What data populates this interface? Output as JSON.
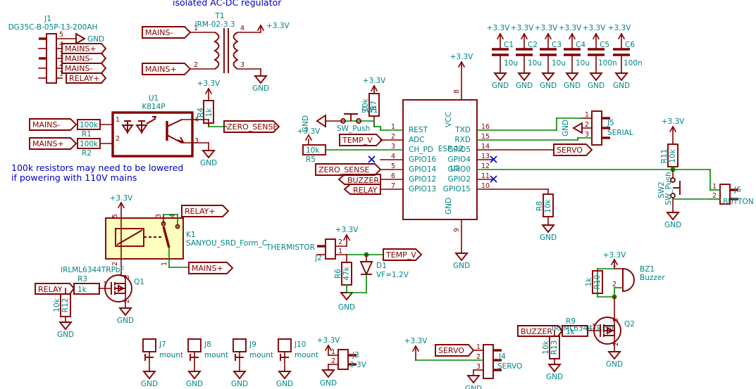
{
  "sheet": {
    "title_block_note": "isolated AC-DC regulator",
    "warning_note_line1": "100k resistors may need to be lowered",
    "warning_note_line2": "if powering with 110V mains"
  },
  "nets": {
    "vcc": "+3.3V",
    "gnd": "GND",
    "mains_plus": "MAINS+",
    "mains_minus": "MAINS-",
    "relay_plus": "RELAY+",
    "relay": "RELAY",
    "zero_sense": "ZERO_SENSE",
    "temp_v": "TEMP_V",
    "buzzer": "BUZZER",
    "servo": "SERVO"
  },
  "components": {
    "J1": {
      "ref": "J1",
      "value": "DG35C-B-05P-13-200AH",
      "pins": [
        {
          "num": "5",
          "label": "GND"
        },
        {
          "num": "4",
          "label": "MAINS+"
        },
        {
          "num": "3",
          "label": "MAINS-"
        },
        {
          "num": "2",
          "label": "MAINS-"
        },
        {
          "num": "1",
          "label": "RELAY+"
        }
      ]
    },
    "T1": {
      "ref": "T1",
      "value": "IRM-02-3.3",
      "pins": [
        "1",
        "2",
        "3",
        "4"
      ],
      "in_minus": "MAINS-",
      "in_plus": "MAINS+",
      "out_plus": "+3.3V",
      "out_gnd": "GND"
    },
    "U1": {
      "ref": "U1",
      "value": "K814P",
      "pins": [
        "1",
        "2",
        "3",
        "4"
      ]
    },
    "U2": {
      "ref": "U2",
      "value": "ESP-12",
      "pin_vcc": "VCC",
      "pin_gnd": "GND",
      "pin_vcc_num": "8",
      "pin_gnd_num": "9",
      "left_pins": [
        {
          "num": "1",
          "name": "REST"
        },
        {
          "num": "2",
          "name": "ADC"
        },
        {
          "num": "3",
          "name": "CH_PD"
        },
        {
          "num": "4",
          "name": "GPIO16"
        },
        {
          "num": "5",
          "name": "GPIO14"
        },
        {
          "num": "6",
          "name": "GPIO12"
        },
        {
          "num": "7",
          "name": "GPIO13"
        }
      ],
      "right_pins": [
        {
          "num": "16",
          "name": "TXD"
        },
        {
          "num": "15",
          "name": "RXD"
        },
        {
          "num": "14",
          "name": "GPIO5"
        },
        {
          "num": "13",
          "name": "GPIO4"
        },
        {
          "num": "12",
          "name": "GPIO0"
        },
        {
          "num": "11",
          "name": "GPIO2"
        },
        {
          "num": "10",
          "name": "GPIO15"
        }
      ]
    },
    "K1": {
      "ref": "K1",
      "value": "SANYOU_SRD_Form_C",
      "pins": [
        "1",
        "2",
        "3",
        "4",
        "5"
      ]
    },
    "Q1": {
      "ref": "Q1",
      "value": "IRLML6344TRPbF",
      "pins": [
        "1",
        "2",
        "3"
      ]
    },
    "Q2": {
      "ref": "Q2",
      "value": "IRLML6344TRPbF",
      "pins": [
        "1",
        "2",
        "3"
      ]
    },
    "D1": {
      "ref": "D1",
      "value": "VF=1.2V"
    },
    "BZ1": {
      "ref": "BZ1",
      "value": "Buzzer",
      "pins": [
        "1",
        "2"
      ]
    },
    "SW1": {
      "ref": "SW1",
      "value": "SW_Push"
    },
    "SW2": {
      "ref": "SW2",
      "value": "SW_Push"
    },
    "J2": {
      "ref": "J2",
      "value": "THERMISTOR",
      "pins": [
        "1",
        "2"
      ]
    },
    "J3": {
      "ref": "J3",
      "value": "3 3V",
      "pins": [
        "1",
        "2"
      ]
    },
    "J4": {
      "ref": "J4",
      "value": "SERVO",
      "pins": [
        "1",
        "2",
        "3"
      ]
    },
    "J5": {
      "ref": "J5",
      "value": "SERIAL",
      "pins": [
        "1",
        "2",
        "3"
      ]
    },
    "J6": {
      "ref": "J6",
      "value": "BUTTON",
      "pins": [
        "1",
        "2"
      ]
    },
    "J7": {
      "ref": "J7",
      "value": "mount"
    },
    "J8": {
      "ref": "J8",
      "value": "mount"
    },
    "J9": {
      "ref": "J9",
      "value": "mount"
    },
    "J10": {
      "ref": "J10",
      "value": "mount"
    }
  },
  "capacitors": [
    {
      "ref": "C1",
      "value": "10u",
      "rail": "+3.3V",
      "gnd": "GND"
    },
    {
      "ref": "C2",
      "value": "10u",
      "rail": "+3.3V",
      "gnd": "GND"
    },
    {
      "ref": "C3",
      "value": "10u",
      "rail": "+3.3V",
      "gnd": "GND"
    },
    {
      "ref": "C4",
      "value": "10u",
      "rail": "+3.3V",
      "gnd": "GND"
    },
    {
      "ref": "C5",
      "value": "100n",
      "rail": "+3.3V",
      "gnd": "GND"
    },
    {
      "ref": "C6",
      "value": "100n",
      "rail": "+3.3V",
      "gnd": "GND"
    }
  ],
  "resistors": [
    {
      "ref": "R1",
      "value": "100k"
    },
    {
      "ref": "R2",
      "value": "100k"
    },
    {
      "ref": "R3",
      "value": "1k"
    },
    {
      "ref": "R4",
      "value": "1k"
    },
    {
      "ref": "R5",
      "value": "10k"
    },
    {
      "ref": "R6",
      "value": "47k"
    },
    {
      "ref": "R7",
      "value": "10k"
    },
    {
      "ref": "R8",
      "value": "10k"
    },
    {
      "ref": "R9",
      "value": "1k"
    },
    {
      "ref": "R10",
      "value": "1k"
    },
    {
      "ref": "R11",
      "value": "10k"
    },
    {
      "ref": "R12",
      "value": "10k"
    },
    {
      "ref": "R13",
      "value": "10k"
    }
  ],
  "colors": {
    "wire": "#840000",
    "net_green": "#008400",
    "component_text": "#008484",
    "note_text": "#0000c0",
    "relay_fill": "#ffffc0"
  }
}
